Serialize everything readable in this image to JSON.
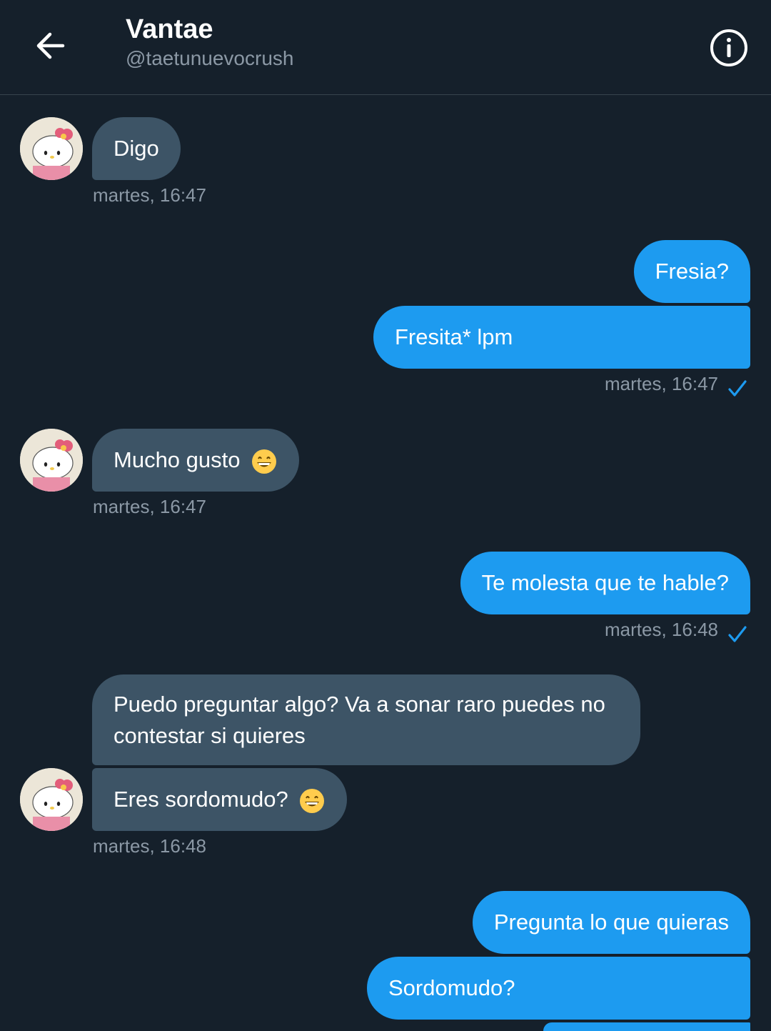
{
  "header": {
    "name": "Vantae",
    "handle": "@taetunuevocrush"
  },
  "colors": {
    "background": "#15202b",
    "incoming_bubble": "#3d5466",
    "outgoing_bubble": "#1d9bf0",
    "timestamp": "#8b98a5",
    "sent_check": "#1d9bf0"
  },
  "messages": [
    {
      "from": "them",
      "text": "Digo"
    },
    {
      "from": "them",
      "timestamp": "martes, 16:47"
    },
    {
      "from": "me",
      "text": "Fresia?"
    },
    {
      "from": "me",
      "text": "Fresita* lpm"
    },
    {
      "from": "me",
      "timestamp": "martes, 16:47",
      "status_icon": "check-icon"
    },
    {
      "from": "them",
      "text": "Mucho gusto",
      "emoji": "grinning-face-icon"
    },
    {
      "from": "them",
      "timestamp": "martes, 16:47"
    },
    {
      "from": "me",
      "text": "Te molesta que te hable?"
    },
    {
      "from": "me",
      "timestamp": "martes, 16:48",
      "status_icon": "check-icon"
    },
    {
      "from": "them",
      "text": "Puedo preguntar algo? Va a sonar raro puedes no contestar si quieres"
    },
    {
      "from": "them",
      "text": "Eres sordomudo?",
      "emoji": "grinning-face-icon"
    },
    {
      "from": "them",
      "timestamp": "martes, 16:48"
    },
    {
      "from": "me",
      "text": "Pregunta lo que quieras"
    },
    {
      "from": "me",
      "text": "Sordomudo?"
    }
  ]
}
